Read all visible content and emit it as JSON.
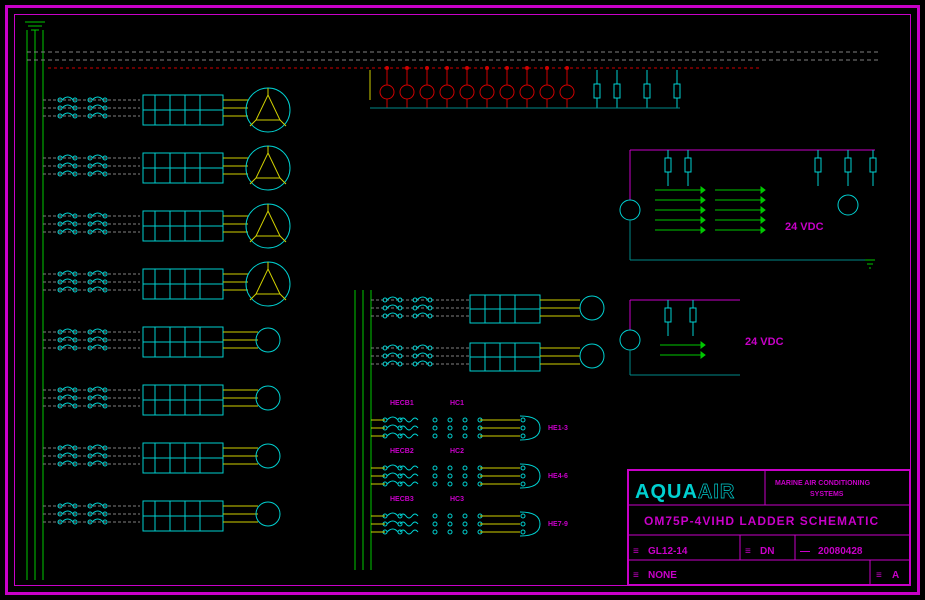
{
  "title_block": {
    "logo_main": "AQUA",
    "logo_sub": "AIR",
    "tagline1": "MARINE AIR CONDITIONING",
    "tagline2": "SYSTEMS",
    "drawing_title": "OM75P-4VIHD LADDER SCHEMATIC",
    "scale_prefix": "≡",
    "scale": "GL12-14",
    "drawn_by_prefix": "≡",
    "drawn_by": "DN",
    "date_prefix": "—",
    "date": "20080428",
    "sheet_prefix": "≡",
    "sheet": "NONE",
    "rev_prefix": "≡",
    "rev": "A"
  },
  "voltage_labels": {
    "block1": "24 VDC",
    "block2": "24 VDC"
  },
  "heater_labels": {
    "col1": [
      "HECB1",
      "HECB2",
      "HECB3"
    ],
    "col2": [
      "HC1",
      "HC2",
      "HC3"
    ],
    "col3": [
      "HE1-3",
      "HE4-6",
      "HE7-9"
    ]
  },
  "schematic": {
    "type": "ladder_electrical_schematic",
    "description": "Three-phase power distribution ladder diagram with motor circuits, control relays, and 24VDC control blocks",
    "main_bus": {
      "phases": 3,
      "entry": "top-left"
    },
    "motor_rows": 8,
    "motor_types": {
      "delta_wye": 4,
      "standard": 4
    },
    "indicator_row": {
      "lamps": 10,
      "fuses": 4,
      "position": "top"
    },
    "center_motor_block": {
      "motors": 2,
      "heater_circuits": 3
    },
    "vdc_blocks": [
      {
        "voltage": "24 VDC",
        "terminals": 8,
        "fuses": 4
      },
      {
        "voltage": "24 VDC",
        "terminals": 2,
        "fuses": 2
      }
    ]
  }
}
